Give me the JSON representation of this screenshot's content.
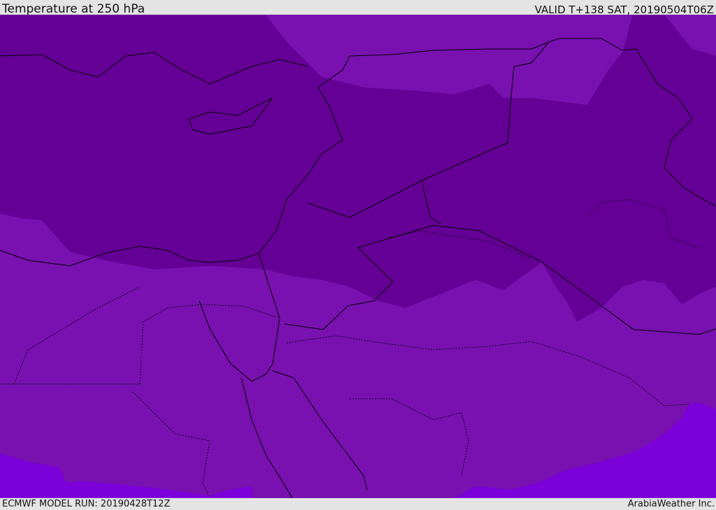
{
  "header": {
    "title": "Temperature at 250 hPa",
    "valid": "VALID T+138 SAT, 20190504T06Z"
  },
  "footer": {
    "model_run": "ECMWF MODEL RUN: 20190428T12Z",
    "credit": "ArabiaWeather Inc."
  },
  "colors": {
    "dark_band": "#650096",
    "mid_band": "#7811b0",
    "bright_band": "#7b00d9",
    "outline": "#000000"
  }
}
